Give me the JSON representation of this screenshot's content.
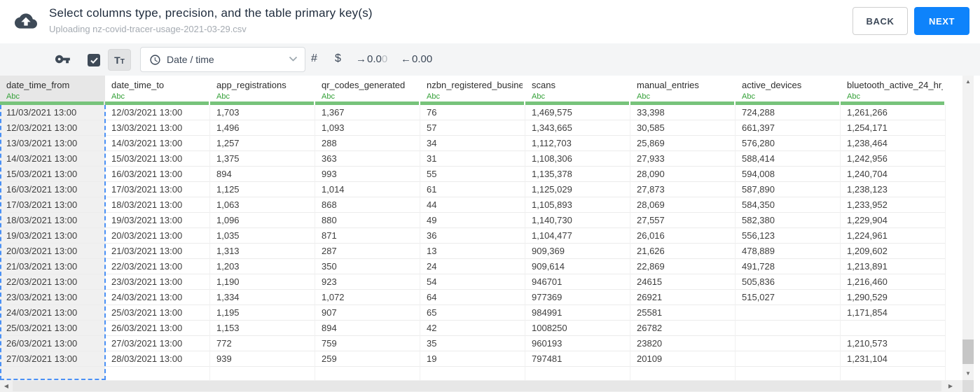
{
  "header": {
    "title": "Select columns type, precision, and the table primary key(s)",
    "subtitle": "Uploading nz-covid-tracer-usage-2021-03-29.csv",
    "back_label": "BACK",
    "next_label": "NEXT"
  },
  "toolbar": {
    "primary_key_icon": "key-icon",
    "include_checkbox_checked": true,
    "text_type_label": "Tt",
    "type_dropdown": {
      "icon": "clock-icon",
      "value": "Date / time"
    },
    "number_label": "#",
    "currency_label": "$",
    "pad_right": {
      "arrow": "→",
      "value_dark": "0.0",
      "value_light": "0"
    },
    "pad_left": {
      "arrow": "←",
      "value": "0.00"
    }
  },
  "table": {
    "columns": [
      {
        "name": "date_time_from",
        "type": "Abc",
        "selected": true
      },
      {
        "name": "date_time_to",
        "type": "Abc",
        "selected": false
      },
      {
        "name": "app_registrations",
        "type": "Abc",
        "selected": false
      },
      {
        "name": "qr_codes_generated",
        "type": "Abc",
        "selected": false
      },
      {
        "name": "nzbn_registered_busine",
        "type": "Abc",
        "selected": false
      },
      {
        "name": "scans",
        "type": "Abc",
        "selected": false
      },
      {
        "name": "manual_entries",
        "type": "Abc",
        "selected": false
      },
      {
        "name": "active_devices",
        "type": "Abc",
        "selected": false
      },
      {
        "name": "bluetooth_active_24_hr_",
        "type": "Abc",
        "selected": false
      }
    ],
    "rows": [
      [
        "11/03/2021 13:00",
        "12/03/2021 13:00",
        "1,703",
        "1,367",
        "76",
        "1,469,575",
        "33,398",
        "724,288",
        "1,261,266"
      ],
      [
        "12/03/2021 13:00",
        "13/03/2021 13:00",
        "1,496",
        "1,093",
        "57",
        "1,343,665",
        "30,585",
        "661,397",
        "1,254,171"
      ],
      [
        "13/03/2021 13:00",
        "14/03/2021 13:00",
        "1,257",
        "288",
        "34",
        "1,112,703",
        "25,869",
        "576,280",
        "1,238,464"
      ],
      [
        "14/03/2021 13:00",
        "15/03/2021 13:00",
        "1,375",
        "363",
        "31",
        "1,108,306",
        "27,933",
        "588,414",
        "1,242,956"
      ],
      [
        "15/03/2021 13:00",
        "16/03/2021 13:00",
        "894",
        "993",
        "55",
        "1,135,378",
        "28,090",
        "594,008",
        "1,240,704"
      ],
      [
        "16/03/2021 13:00",
        "17/03/2021 13:00",
        "1,125",
        "1,014",
        "61",
        "1,125,029",
        "27,873",
        "587,890",
        "1,238,123"
      ],
      [
        "17/03/2021 13:00",
        "18/03/2021 13:00",
        "1,063",
        "868",
        "44",
        "1,105,893",
        "28,069",
        "584,350",
        "1,233,952"
      ],
      [
        "18/03/2021 13:00",
        "19/03/2021 13:00",
        "1,096",
        "880",
        "49",
        "1,140,730",
        "27,557",
        "582,380",
        "1,229,904"
      ],
      [
        "19/03/2021 13:00",
        "20/03/2021 13:00",
        "1,035",
        "871",
        "36",
        "1,104,477",
        "26,016",
        "556,123",
        "1,224,961"
      ],
      [
        "20/03/2021 13:00",
        "21/03/2021 13:00",
        "1,313",
        "287",
        "13",
        "909,369",
        "21,626",
        "478,889",
        "1,209,602"
      ],
      [
        "21/03/2021 13:00",
        "22/03/2021 13:00",
        "1,203",
        "350",
        "24",
        "909,614",
        "22,869",
        "491,728",
        "1,213,891"
      ],
      [
        "22/03/2021 13:00",
        "23/03/2021 13:00",
        "1,190",
        "923",
        "54",
        "946701",
        "24615",
        "505,836",
        "1,216,460"
      ],
      [
        "23/03/2021 13:00",
        "24/03/2021 13:00",
        "1,334",
        "1,072",
        "64",
        "977369",
        "26921",
        "515,027",
        "1,290,529"
      ],
      [
        "24/03/2021 13:00",
        "25/03/2021 13:00",
        "1,195",
        "907",
        "65",
        "984991",
        "25581",
        "",
        "1,171,854"
      ],
      [
        "25/03/2021 13:00",
        "26/03/2021 13:00",
        "1,153",
        "894",
        "42",
        "1008250",
        "26782",
        "",
        ""
      ],
      [
        "26/03/2021 13:00",
        "27/03/2021 13:00",
        "772",
        "759",
        "35",
        "960193",
        "23820",
        "",
        "1,210,573"
      ],
      [
        "27/03/2021 13:00",
        "28/03/2021 13:00",
        "939",
        "259",
        "19",
        "797481",
        "20109",
        "",
        "1,231,104"
      ]
    ]
  },
  "colors": {
    "accent_blue": "#0e83fb",
    "header_bar_green": "#77c37b",
    "type_label_green": "#33a037",
    "selection_dash_blue": "#4a90f5",
    "toolbar_bg": "#f4f5f6",
    "icon_navy": "#3e4a57"
  }
}
